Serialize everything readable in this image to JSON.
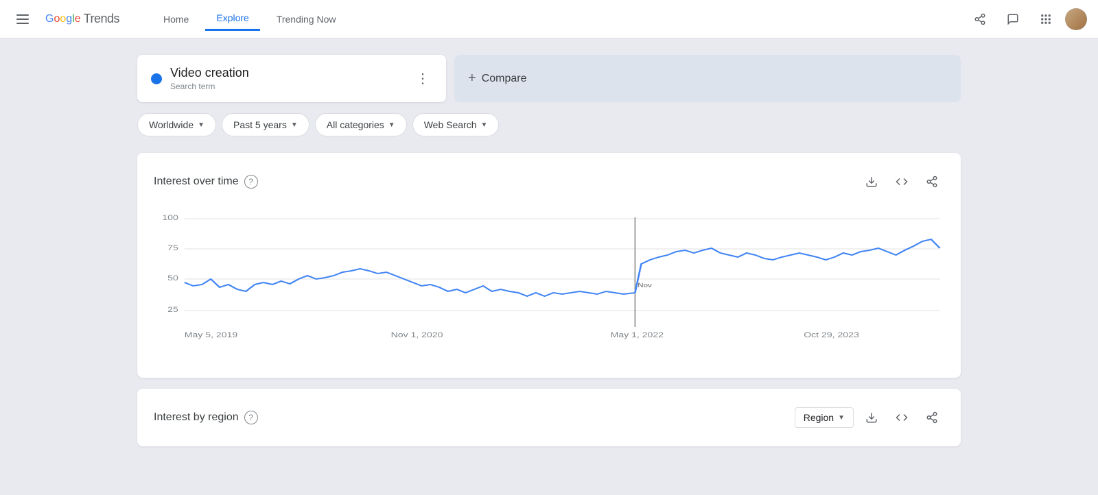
{
  "header": {
    "menu_icon": "menu",
    "logo_text": "Google",
    "logo_suffix": "Trends",
    "nav": [
      {
        "label": "Home",
        "active": false
      },
      {
        "label": "Explore",
        "active": true
      },
      {
        "label": "Trending Now",
        "active": false
      }
    ],
    "share_icon": "share",
    "message_icon": "message",
    "apps_icon": "apps",
    "avatar_label": "User avatar"
  },
  "search": {
    "term": "Video creation",
    "term_type": "Search term",
    "compare_label": "Compare",
    "dot_color": "#1a73e8"
  },
  "filters": [
    {
      "label": "Worldwide",
      "id": "geo-filter"
    },
    {
      "label": "Past 5 years",
      "id": "time-filter"
    },
    {
      "label": "All categories",
      "id": "category-filter"
    },
    {
      "label": "Web Search",
      "id": "search-type-filter"
    }
  ],
  "interest_over_time": {
    "title": "Interest over time",
    "help": "?",
    "y_labels": [
      "100",
      "75",
      "50",
      "25"
    ],
    "x_labels": [
      "May 5, 2019",
      "Nov 1, 2020",
      "May 1, 2022",
      "Oct 29, 2023"
    ],
    "download_icon": "download",
    "embed_icon": "embed",
    "share_icon": "share"
  },
  "interest_by_region": {
    "title": "Interest by region",
    "help": "?",
    "region_label": "Region",
    "download_icon": "download",
    "embed_icon": "embed",
    "share_icon": "share"
  },
  "chart": {
    "line_color": "#1a73e8",
    "accent_color": "#1a73e8",
    "divider_x": 0.57
  }
}
